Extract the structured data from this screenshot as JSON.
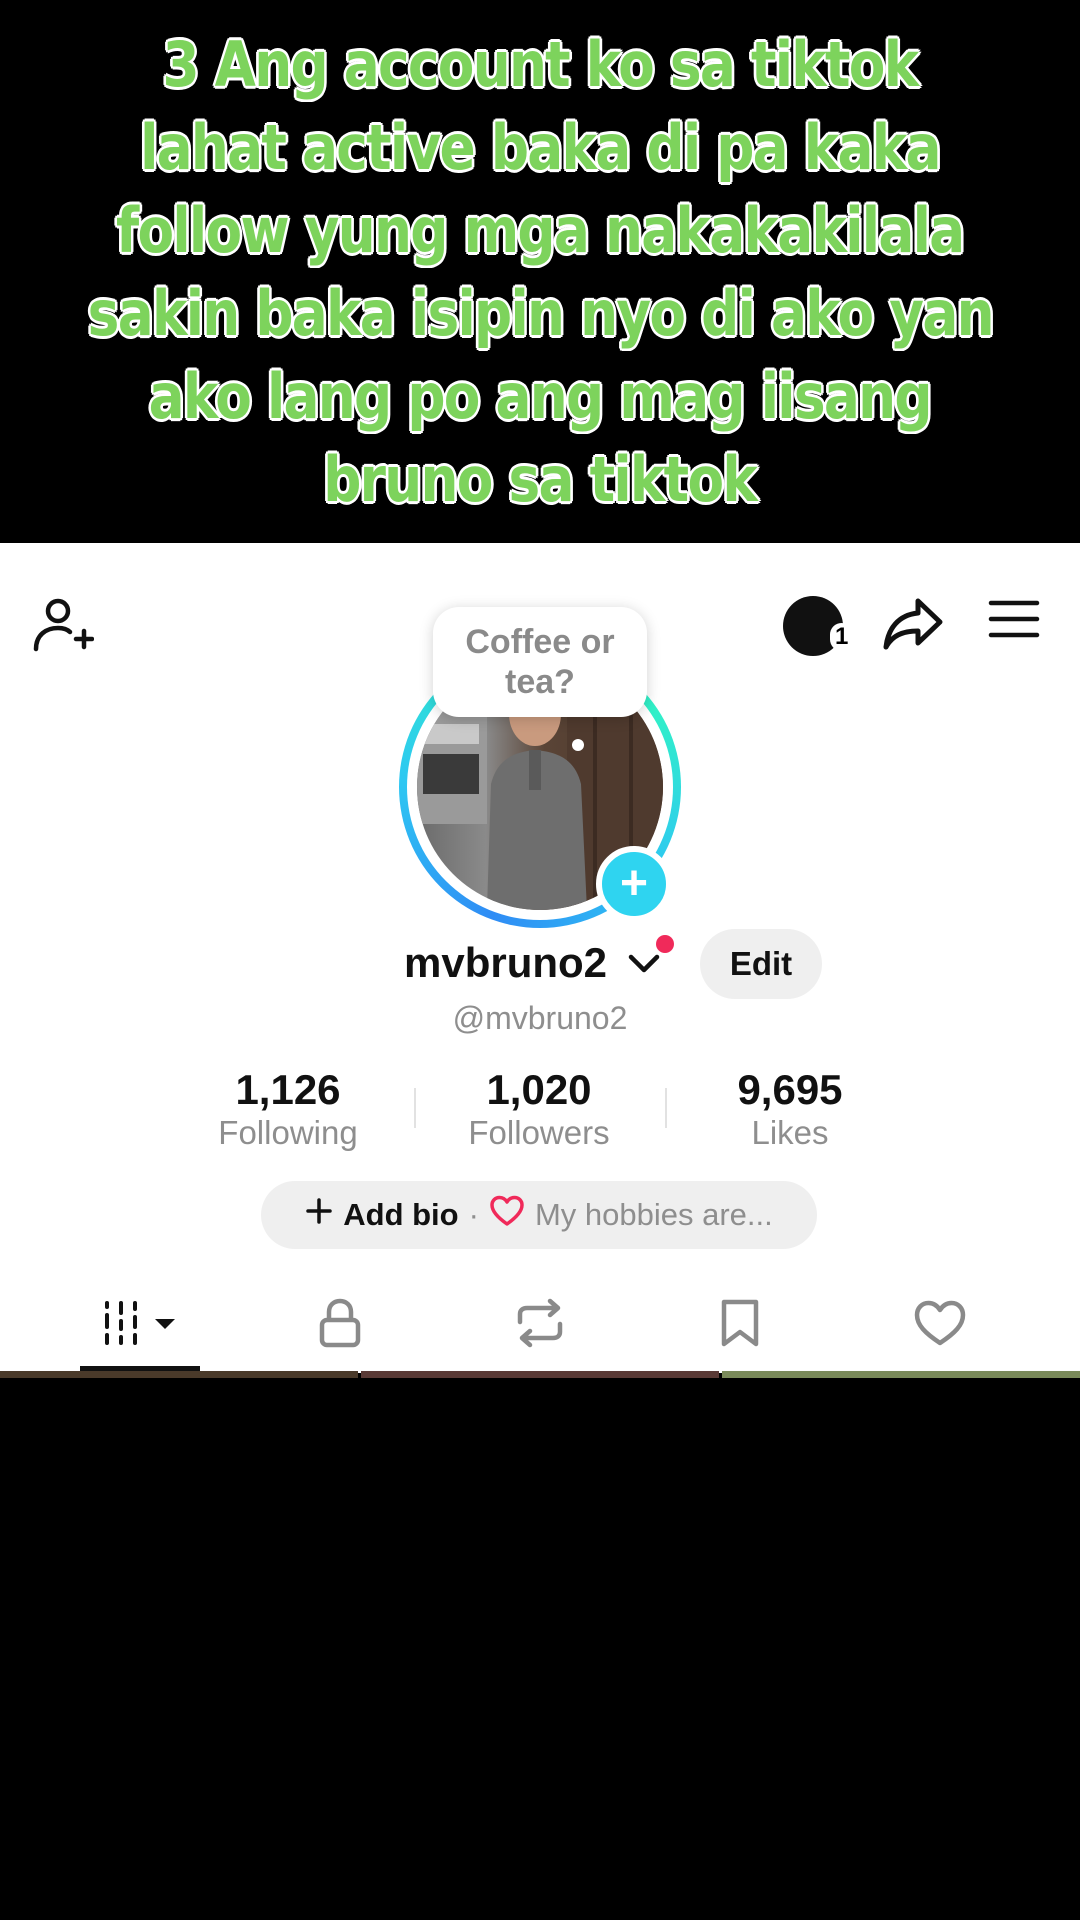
{
  "caption": {
    "lines": [
      "3 Ang account ko sa tiktok",
      "lahat active baka di pa kaka",
      "follow yung mga nakakakilala",
      "sakin baka isipin nyo  di ako yan",
      "ako lang  po ang mag iisang",
      "bruno sa tiktok"
    ],
    "text_color": "#7dd35c",
    "outline_color": "#ffffff"
  },
  "header": {
    "inbox_badge": "1"
  },
  "profile": {
    "bubble_text": "Coffee or tea?",
    "display_name": "mvbruno2",
    "edit_label": "Edit",
    "handle": "@mvbruno2",
    "online_dot_color": "#f02a5a",
    "plus_color": "#2fd4f0"
  },
  "stats": [
    {
      "value": "1,126",
      "label": "Following"
    },
    {
      "value": "1,020",
      "label": "Followers"
    },
    {
      "value": "9,695",
      "label": "Likes"
    }
  ],
  "bio": {
    "add_label": "Add bio",
    "separator": "·",
    "hobbies_text": "My hobbies are..."
  },
  "tabs": [
    {
      "icon": "grid-icon"
    },
    {
      "icon": "lock-icon"
    },
    {
      "icon": "repost-icon"
    },
    {
      "icon": "bookmark-icon"
    },
    {
      "icon": "heart-icon"
    }
  ]
}
